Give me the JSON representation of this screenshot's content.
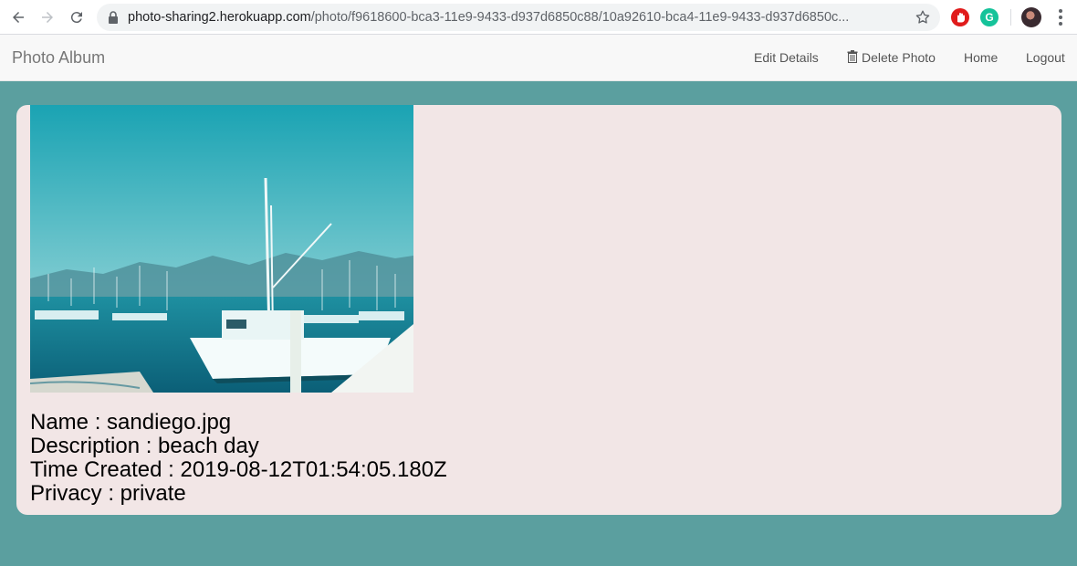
{
  "browser": {
    "url_host": "photo-sharing2.herokuapp.com",
    "url_path": "/photo/f9618600-bca3-11e9-9433-d937d6850c88/10a92610-bca4-11e9-9433-d937d6850c...",
    "extensions": [
      "adblock-icon",
      "grammarly-icon"
    ],
    "grammarly_letter": "G"
  },
  "navbar": {
    "brand": "Photo Album",
    "edit_label": "Edit Details",
    "delete_label": "Delete Photo",
    "home_label": "Home",
    "logout_label": "Logout"
  },
  "photo": {
    "alt": "sandiego.jpg",
    "details": [
      {
        "label": "Name",
        "value": "sandiego.jpg"
      },
      {
        "label": "Description",
        "value": "beach day"
      },
      {
        "label": "Time Created",
        "value": "2019-08-12T01:54:05.180Z"
      },
      {
        "label": "Privacy",
        "value": "private"
      }
    ],
    "name_line": "Name : sandiego.jpg",
    "description_line": "Description : beach day",
    "time_line": "Time Created : 2019-08-12T01:54:05.180Z",
    "privacy_line": "Privacy : private"
  },
  "colors": {
    "page_background": "#5b9f9f",
    "card_background": "#f2e6e6",
    "navbar_background": "#f8f8f8"
  }
}
